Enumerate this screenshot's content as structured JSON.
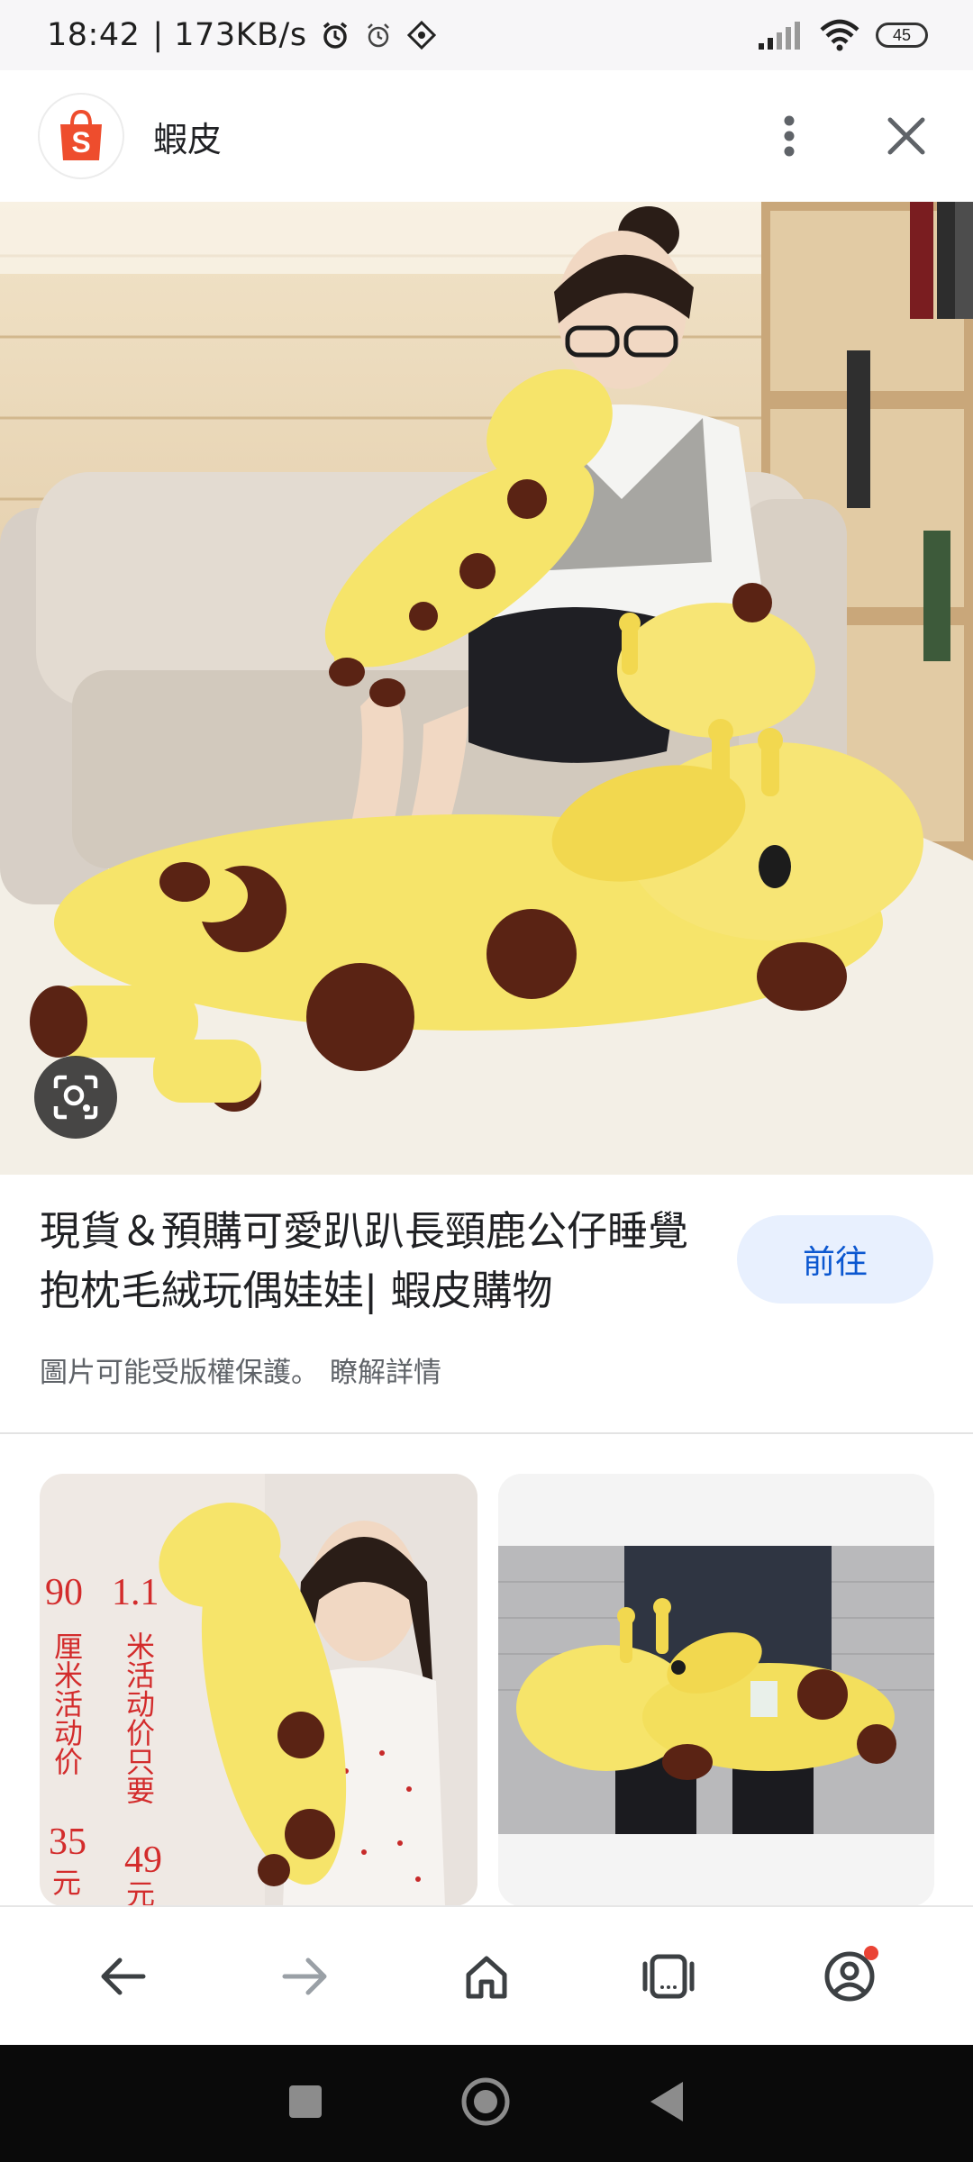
{
  "status_bar": {
    "time": "18:42",
    "speed": "| 173KB/s",
    "battery": "45",
    "icons": [
      "alarm-icon",
      "alarm-outline-icon",
      "location-icon",
      "signal-icon",
      "wifi-icon",
      "battery-icon"
    ]
  },
  "header": {
    "site_name": "蝦皮",
    "logo_letter": "S",
    "logo_color": "#ee4d2d",
    "menu_icon": "more-vert-icon",
    "close_icon": "close-icon"
  },
  "result": {
    "title": "現貨＆預購可愛趴趴長頸鹿公仔睡覺抱枕毛絨玩偶娃娃| 蝦皮購物",
    "visit_label": "前往",
    "copyright_text": "圖片可能受版權保護。",
    "learn_more": "瞭解詳情"
  },
  "related": {
    "thumb1_text": {
      "col1_num": "90",
      "col1_chars": "厘米活动价",
      "col1_price": "35",
      "col1_unit": "元",
      "col2_num": "1.1",
      "col2_chars": "米活动价只要",
      "col2_price": "49",
      "col2_unit": "元"
    }
  },
  "bottom_nav": [
    "back-icon",
    "forward-icon",
    "home-icon",
    "tabs-icon",
    "account-icon"
  ],
  "colors": {
    "accent": "#0b57d0",
    "visit_bg": "#e8f0fe",
    "plush_yellow": "#f6e46a",
    "spot_brown": "#5a2314"
  }
}
